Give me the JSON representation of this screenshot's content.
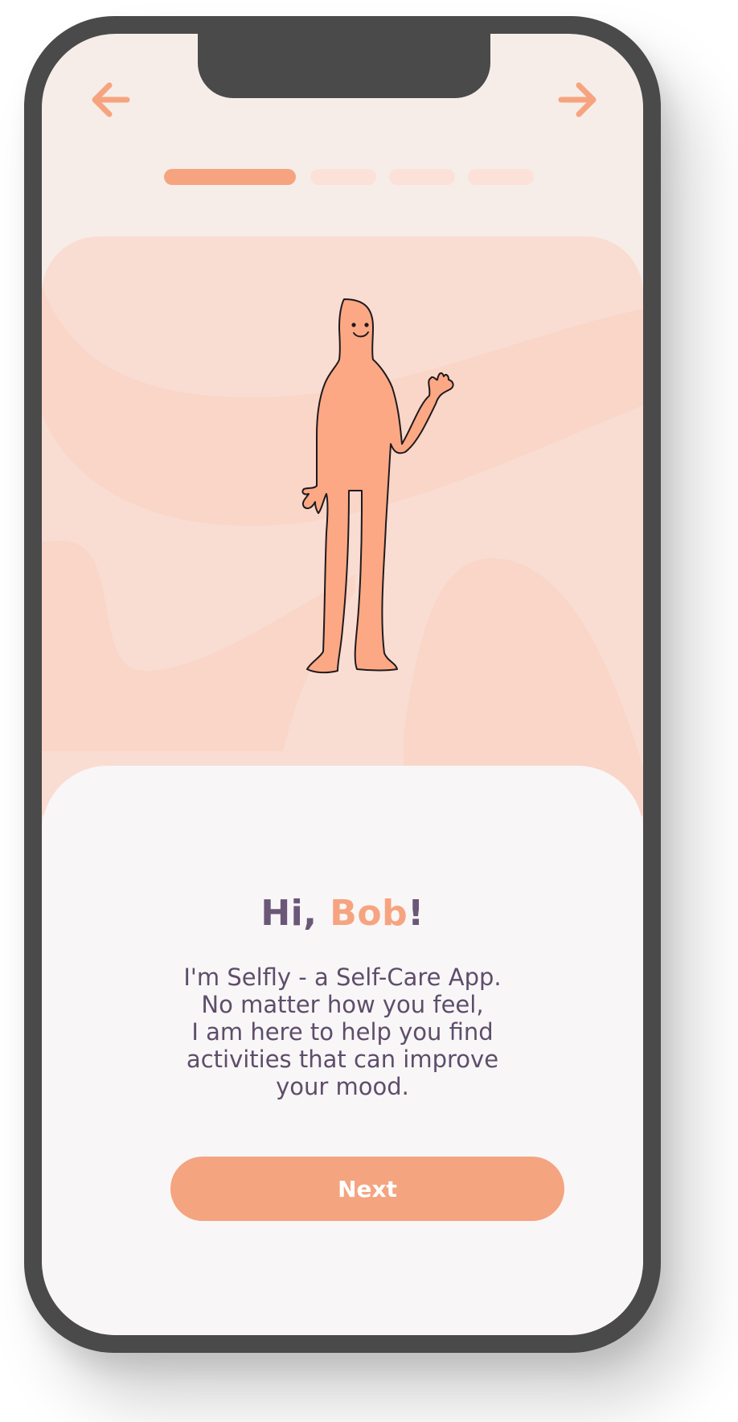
{
  "onboarding": {
    "step_current": 1,
    "step_total": 4,
    "greeting_prefix": "Hi, ",
    "user_name": "Bob",
    "greeting_suffix": "!",
    "intro_lines": [
      "I'm Selfly - a Self-Care App.",
      "No matter how you feel,",
      "I am here to help you find",
      "activities that can improve",
      "your mood."
    ],
    "next_label": "Next"
  },
  "icons": {
    "back": "arrow-left-icon",
    "forward": "arrow-right-icon"
  },
  "colors": {
    "accent": "#f6a47f",
    "text_primary": "#6b5777",
    "screen_bg": "#f6ede9",
    "hero_bg": "#f9ddd2",
    "card_bg": "#f9f6f7",
    "device_frame": "#4a4a4a"
  }
}
